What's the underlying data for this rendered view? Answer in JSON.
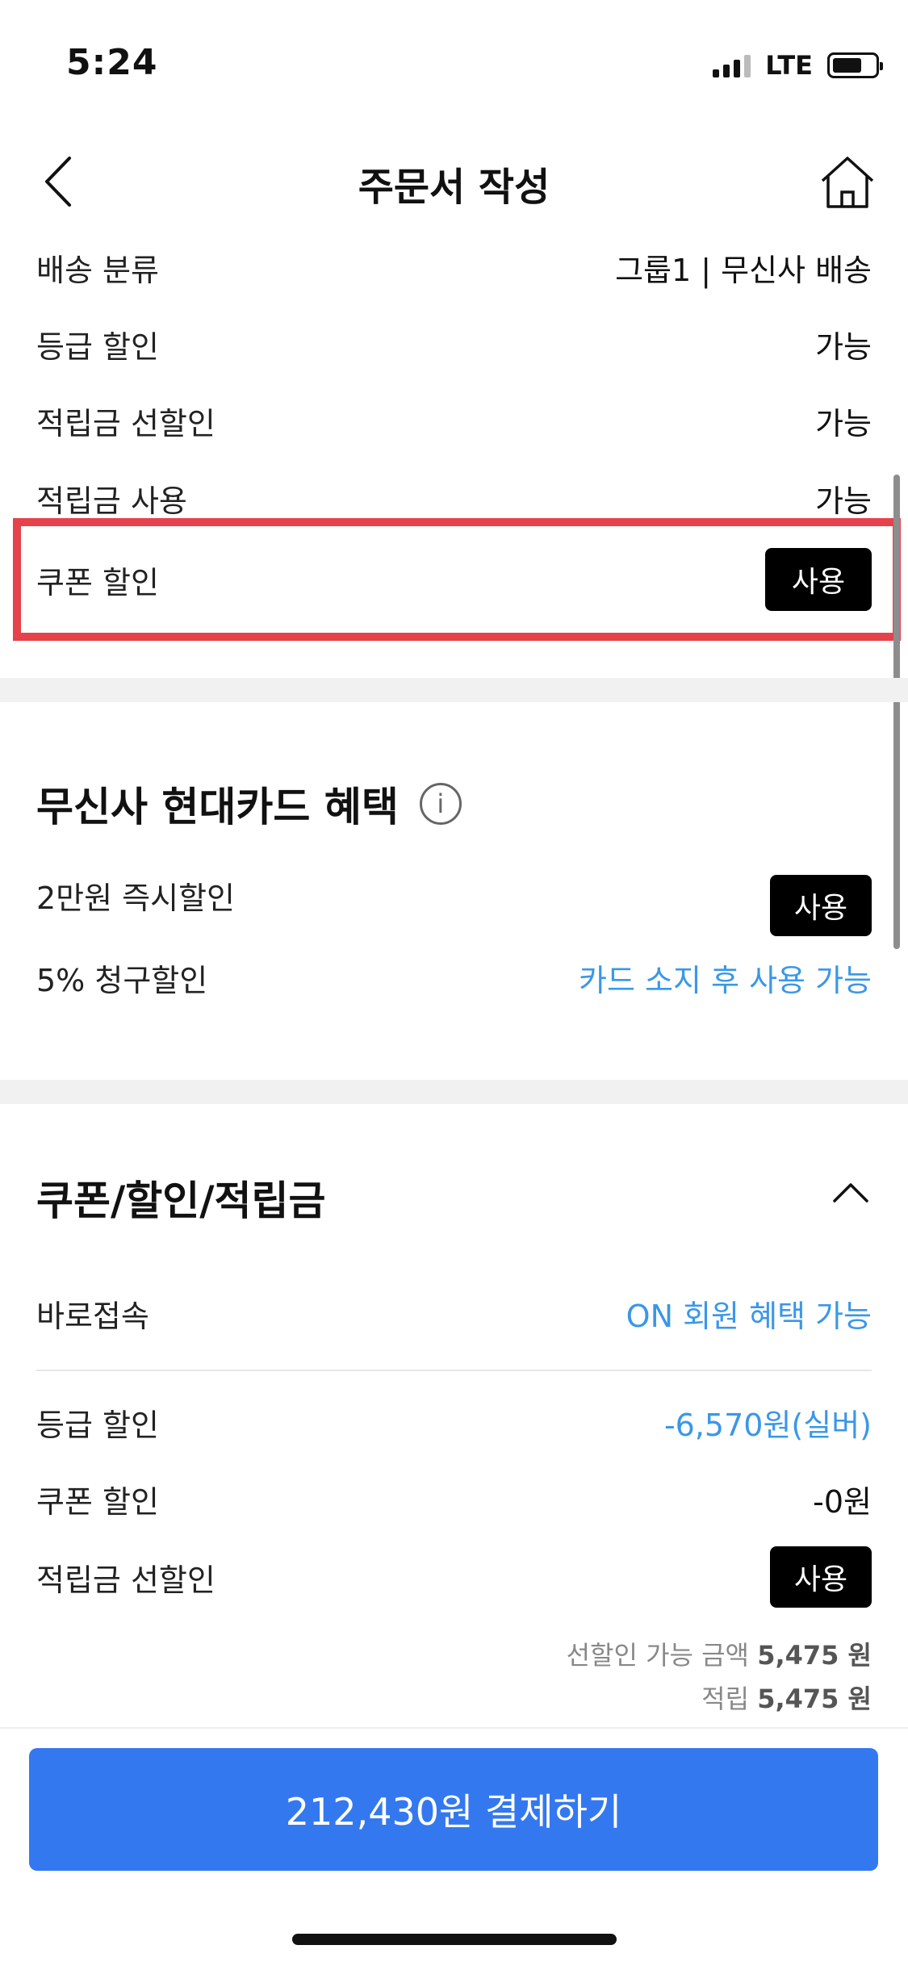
{
  "status_bar": {
    "time": "5:24",
    "network": "LTE"
  },
  "nav": {
    "title": "주문서 작성"
  },
  "order_info": [
    {
      "label": "배송 분류",
      "value": "그룹1 | 무신사 배송"
    },
    {
      "label": "등급 할인",
      "value": "가능"
    },
    {
      "label": "적립금 선할인",
      "value": "가능"
    },
    {
      "label": "적립금 사용",
      "value": "가능"
    }
  ],
  "coupon_row": {
    "label": "쿠폰 할인",
    "button": "사용"
  },
  "card_benefit": {
    "title": "무신사 현대카드 혜택",
    "instant": {
      "label": "2만원 즉시할인",
      "button": "사용"
    },
    "billing": {
      "label": "5% 청구할인",
      "value": "카드 소지 후 사용 가능"
    }
  },
  "discount_section": {
    "title": "쿠폰/할인/적립금",
    "direct": {
      "label": "바로접속",
      "value": "ON 회원 혜택 가능"
    },
    "grade": {
      "label": "등급 할인",
      "value": "-6,570원(실버)"
    },
    "coupon": {
      "label": "쿠폰 할인",
      "value": "-0원"
    },
    "points": {
      "label": "적립금 선할인",
      "button": "사용"
    },
    "pre_discount": {
      "prefix": "선할인 가능 금액",
      "amount": "5,475 원"
    },
    "accrual": {
      "prefix": "적립",
      "amount": "5,475 원"
    }
  },
  "pay_button": "212,430원 결제하기",
  "colors": {
    "accent": "#3478f0",
    "link": "#3a97e8",
    "highlight": "#e5424b"
  }
}
